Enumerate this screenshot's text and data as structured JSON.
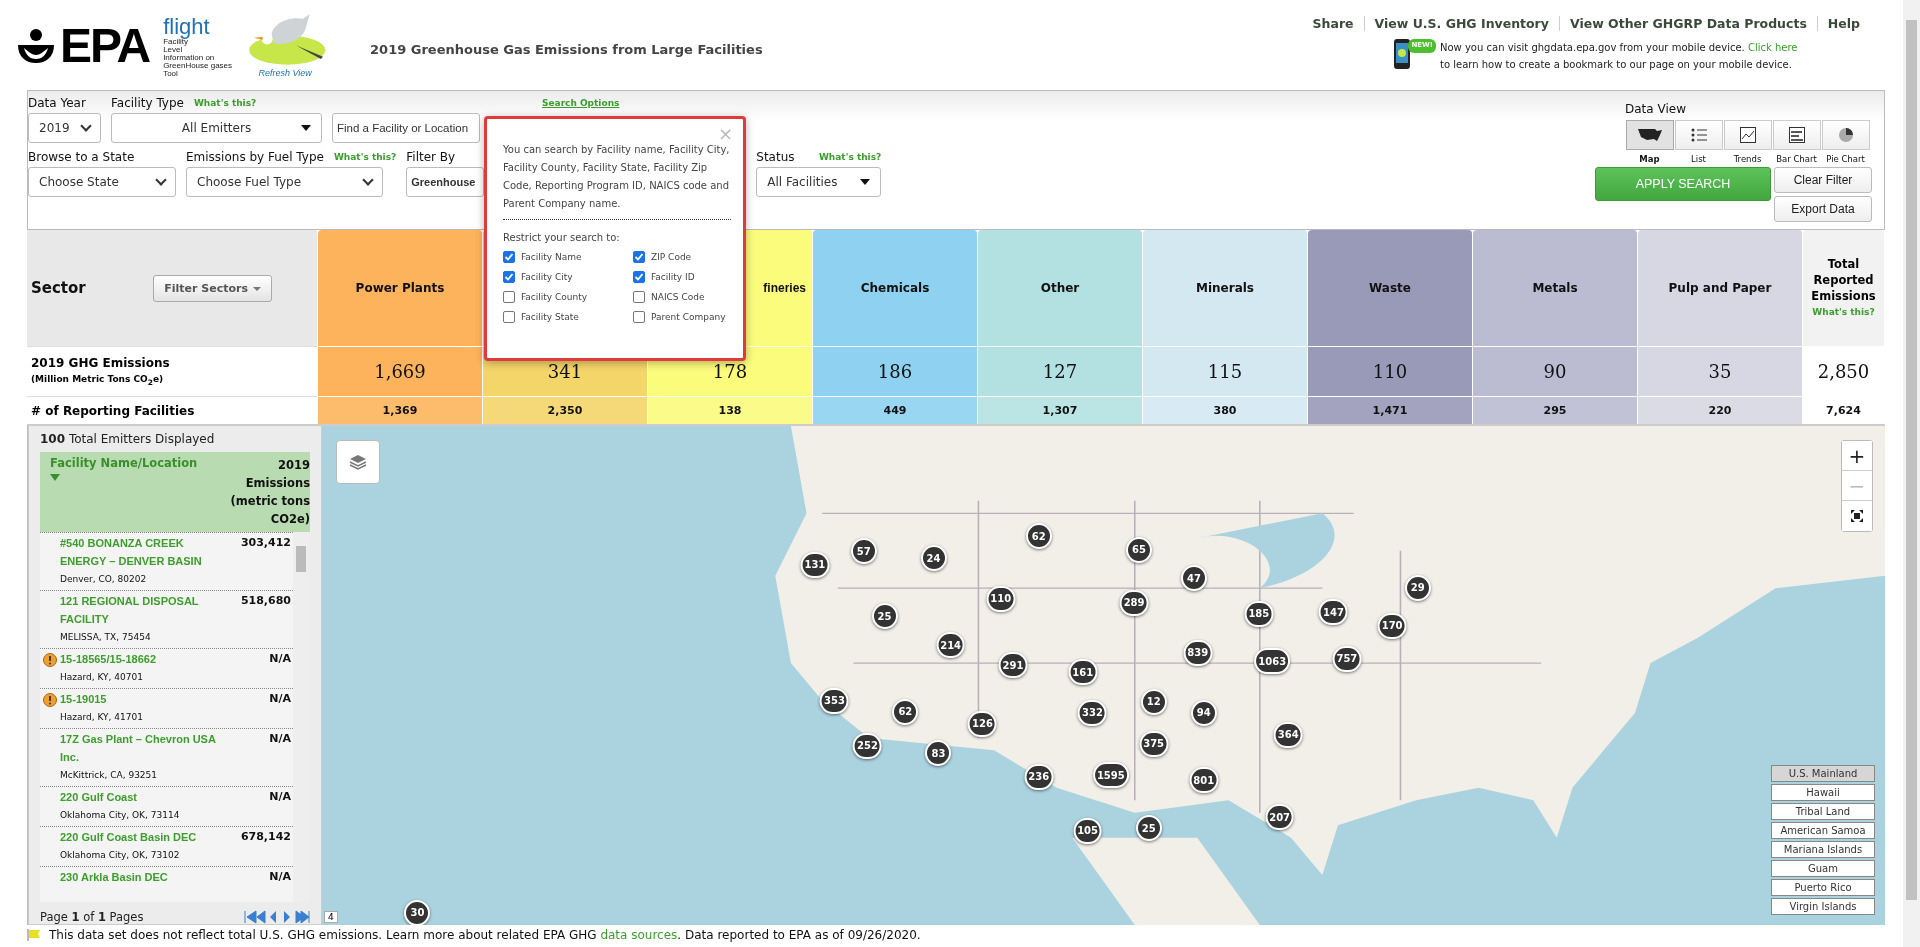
{
  "header": {
    "logo_text": "EPA",
    "app_name": "flight",
    "acronym": [
      "Facility",
      "Level",
      "Information on",
      "GreenHouse gases",
      "Tool"
    ],
    "refresh_link": "Refresh View",
    "page_title": "2019 Greenhouse Gas Emissions from Large Facilities",
    "nav_links": [
      "Share",
      "View U.S. GHG Inventory",
      "View Other GHGRP Data Products",
      "Help"
    ],
    "mobile_badge": "NEW!",
    "mobile_text": "Now you can visit ghgdata.epa.gov from your mobile device.",
    "mobile_link": "Click here",
    "mobile_text_after": "to learn how to create a bookmark to our page on your mobile device."
  },
  "filters": {
    "data_year": {
      "label": "Data Year",
      "value": "2019"
    },
    "facility_type": {
      "label": "Facility Type",
      "help": "What's this?",
      "value": "All Emitters"
    },
    "search": {
      "placeholder": "Find a Facility or Location",
      "options_link": "Search Options"
    },
    "state": {
      "label": "Browse to a State",
      "value": "Choose State"
    },
    "fuel": {
      "label": "Emissions by Fuel Type",
      "help": "What's this?",
      "value": "Choose Fuel Type"
    },
    "filter_by": {
      "label": "Filter By",
      "value": "Greenhouse"
    },
    "status": {
      "label": "Status",
      "help": "What's this?",
      "value": "All Facilities"
    }
  },
  "data_view": {
    "label": "Data View",
    "views": [
      {
        "kind": "map",
        "label": "Map",
        "selected": true
      },
      {
        "kind": "list",
        "label": "List",
        "selected": false
      },
      {
        "kind": "trends",
        "label": "Trends",
        "selected": false
      },
      {
        "kind": "bar",
        "label": "Bar Chart",
        "selected": false
      },
      {
        "kind": "pie",
        "label": "Pie Chart",
        "selected": false
      }
    ],
    "apply_button": "APPLY SEARCH",
    "clear_button": "Clear Filter",
    "export_button": "Export Data"
  },
  "search_popup": {
    "close": "×",
    "text": "You can search by Facility name, Facility City, Facility County, Facility State, Facility Zip Code, Reporting Program ID, NAICS code and Parent Company name.",
    "restrict_label": "Restrict your search to:",
    "options": [
      {
        "label": "Facility Name",
        "checked": true
      },
      {
        "label": "ZIP Code",
        "checked": true
      },
      {
        "label": "Facility City",
        "checked": true
      },
      {
        "label": "Facility ID",
        "checked": true
      },
      {
        "label": "Facility County",
        "checked": false
      },
      {
        "label": "NAICS Code",
        "checked": false
      },
      {
        "label": "Facility State",
        "checked": false
      },
      {
        "label": "Parent Company",
        "checked": false
      }
    ]
  },
  "sectors": {
    "title": "Sector",
    "filter_button": "Filter Sectors",
    "emissions_label": "2019 GHG Emissions",
    "emissions_unit": "(Million Metric Tons CO$_{2}$e)",
    "facilities_label": "# of Reporting Facilities",
    "items": [
      {
        "name": "Power Plants",
        "emissions": "1,669",
        "facilities": "1,369",
        "color": "#fdb35c"
      },
      {
        "emissions": "341",
        "facilities": "2,350",
        "color": "#f4d56a"
      },
      {
        "name": "fineries",
        "emissions": "178",
        "facilities": "138",
        "color": "#fbfb7c"
      },
      {
        "name": "Chemicals",
        "emissions": "186",
        "facilities": "449",
        "color": "#8ed1f0"
      },
      {
        "name": "Other",
        "emissions": "127",
        "facilities": "1,307",
        "color": "#b3e1e1"
      },
      {
        "name": "Minerals",
        "emissions": "115",
        "facilities": "380",
        "color": "#d4e8f2"
      },
      {
        "name": "Waste",
        "emissions": "110",
        "facilities": "1,471",
        "color": "#9999b8"
      },
      {
        "name": "Metals",
        "emissions": "90",
        "facilities": "295",
        "color": "#bbbbd2"
      },
      {
        "name": "Pulp and Paper",
        "emissions": "35",
        "facilities": "220",
        "color": "#d7d7e3"
      }
    ],
    "total": {
      "name": "Total Reported Emissions",
      "help": "What's this?",
      "emissions": "2,850",
      "facilities": "7,624"
    }
  },
  "facility_list": {
    "count": "100",
    "count_label": "Total Emitters Displayed",
    "name_column": "Facility Name/Location",
    "emissions_column": "2019 Emissions (metric tons CO2e)",
    "rows": [
      {
        "name": "#540 BONANZA CREEK ENERGY – DENVER BASIN",
        "location": "Denver, CO, 80202",
        "emissions": "303,412",
        "warning": false
      },
      {
        "name": "121 REGIONAL DISPOSAL FACILITY",
        "location": "MELISSA, TX, 75454",
        "emissions": "518,680",
        "warning": false
      },
      {
        "name": "15-18565/15-18662",
        "location": "Hazard, KY, 40701",
        "emissions": "N/A",
        "warning": true
      },
      {
        "name": "15-19015",
        "location": "Hazard, KY, 41701",
        "emissions": "N/A",
        "warning": true
      },
      {
        "name": "17Z Gas Plant – Chevron USA Inc.",
        "location": "McKittrick, CA, 93251",
        "emissions": "N/A",
        "warning": false
      },
      {
        "name": "220 Gulf Coast",
        "location": "Oklahoma City, OK, 73114",
        "emissions": "N/A",
        "warning": false
      },
      {
        "name": "220 Gulf Coast Basin DEC",
        "location": "Oklahoma City, OK, 73102",
        "emissions": "678,142",
        "warning": false
      },
      {
        "name": "230 Arkla Basin DEC",
        "emissions": "N/A",
        "warning": false
      }
    ],
    "pager": "Page **1** of **1** Pages"
  },
  "map": {
    "zoom_in": "+",
    "zoom_out": "−",
    "scale_label": "4",
    "markers": [
      "131",
      "57",
      "24",
      "62",
      "65",
      "47",
      "110",
      "289",
      "185",
      "147",
      "29",
      "25",
      "170",
      "214",
      "291",
      "839",
      "1063",
      "757",
      "161",
      "353",
      "62",
      "12",
      "332",
      "94",
      "126",
      "375",
      "364",
      "252",
      "83",
      "236",
      "1595",
      "801",
      "207",
      "105",
      "25",
      "30"
    ],
    "regions": [
      {
        "label": "U.S. Mainland",
        "selected": true
      },
      {
        "label": "Hawaii",
        "selected": false
      },
      {
        "label": "Tribal Land",
        "selected": false
      },
      {
        "label": "American Samoa",
        "selected": false
      },
      {
        "label": "Mariana Islands",
        "selected": false
      },
      {
        "label": "Guam",
        "selected": false
      },
      {
        "label": "Puerto Rico",
        "selected": false
      },
      {
        "label": "Virgin Islands",
        "selected": false
      }
    ]
  },
  "footer": {
    "text": "This data set does not reflect total U.S. GHG emissions. Learn more about related EPA GHG",
    "link": "data sources",
    "text_after": ". Data reported to EPA as of 09/26/2020."
  }
}
